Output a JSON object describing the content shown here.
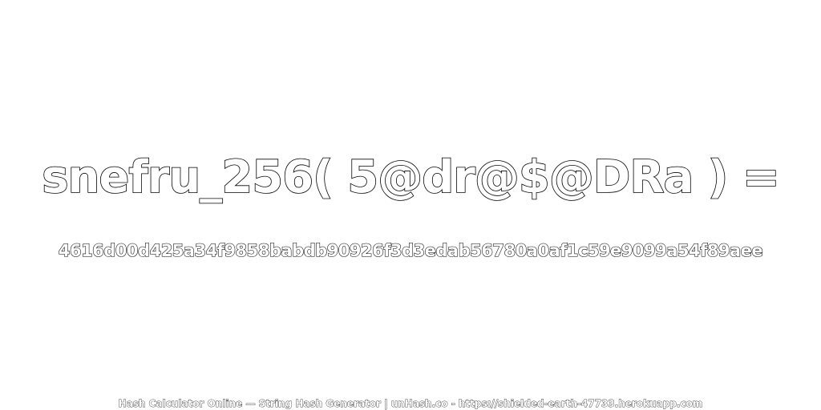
{
  "expression": "snefru_256( 5@dr@$@DRa ) =",
  "hash": "4616d00d425a34f9858babdb90926f3d3edab56780a0af1c59e9099a54f89aee",
  "footer": "Hash Calculator Online — String Hash Generator | unHash.co - https://shielded-earth-47733.herokuapp.com"
}
